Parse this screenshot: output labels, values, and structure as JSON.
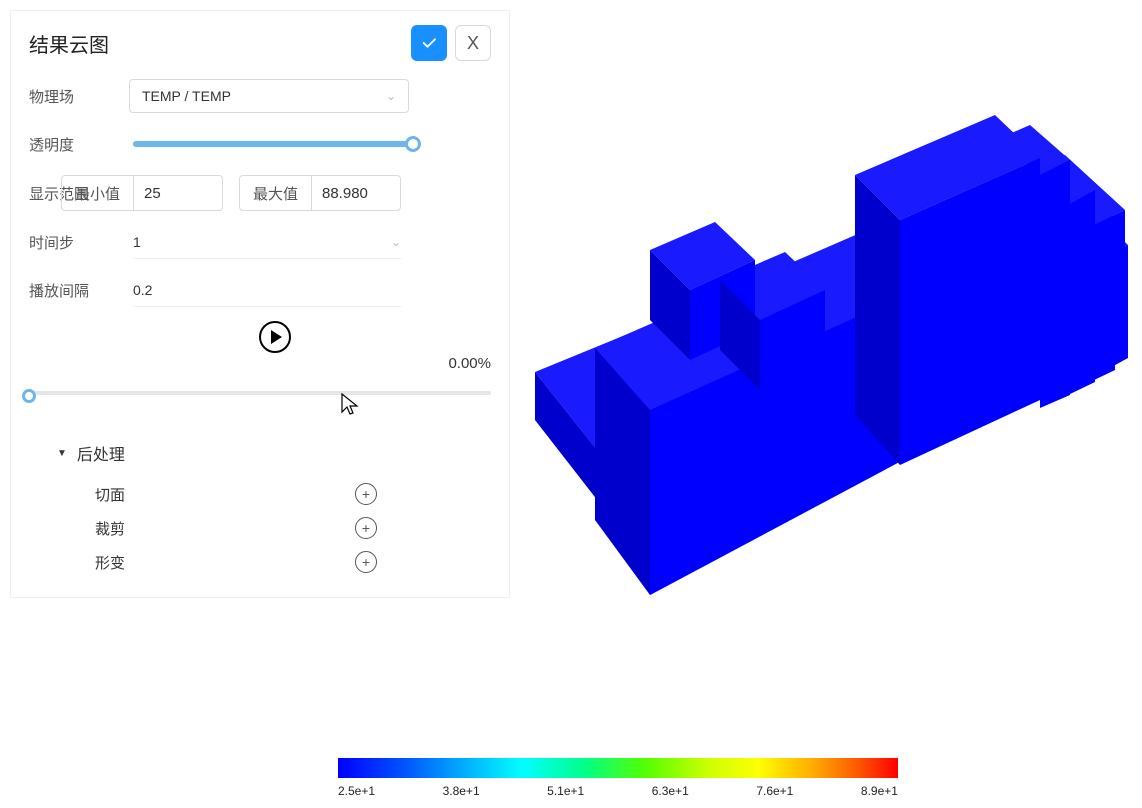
{
  "panel": {
    "title": "结果云图",
    "fields": {
      "physics_label": "物理场",
      "physics_value": "TEMP / TEMP",
      "opacity_label": "透明度",
      "opacity_percent": 100,
      "range_label": "显示范围",
      "range_min_label": "最小值",
      "range_min_value": "25",
      "range_max_label": "最大值",
      "range_max_value": "88.980",
      "timestep_label": "时间步",
      "timestep_value": "1",
      "interval_label": "播放间隔",
      "interval_value": "0.2"
    },
    "progress_pct": "0.00%",
    "post": {
      "header": "后处理",
      "items": [
        {
          "label": "切面"
        },
        {
          "label": "裁剪"
        },
        {
          "label": "形变"
        }
      ]
    }
  },
  "legend": {
    "ticks": [
      "2.5e+1",
      "3.8e+1",
      "5.1e+1",
      "6.3e+1",
      "7.6e+1",
      "8.9e+1"
    ]
  },
  "model_color": "#0000ff"
}
